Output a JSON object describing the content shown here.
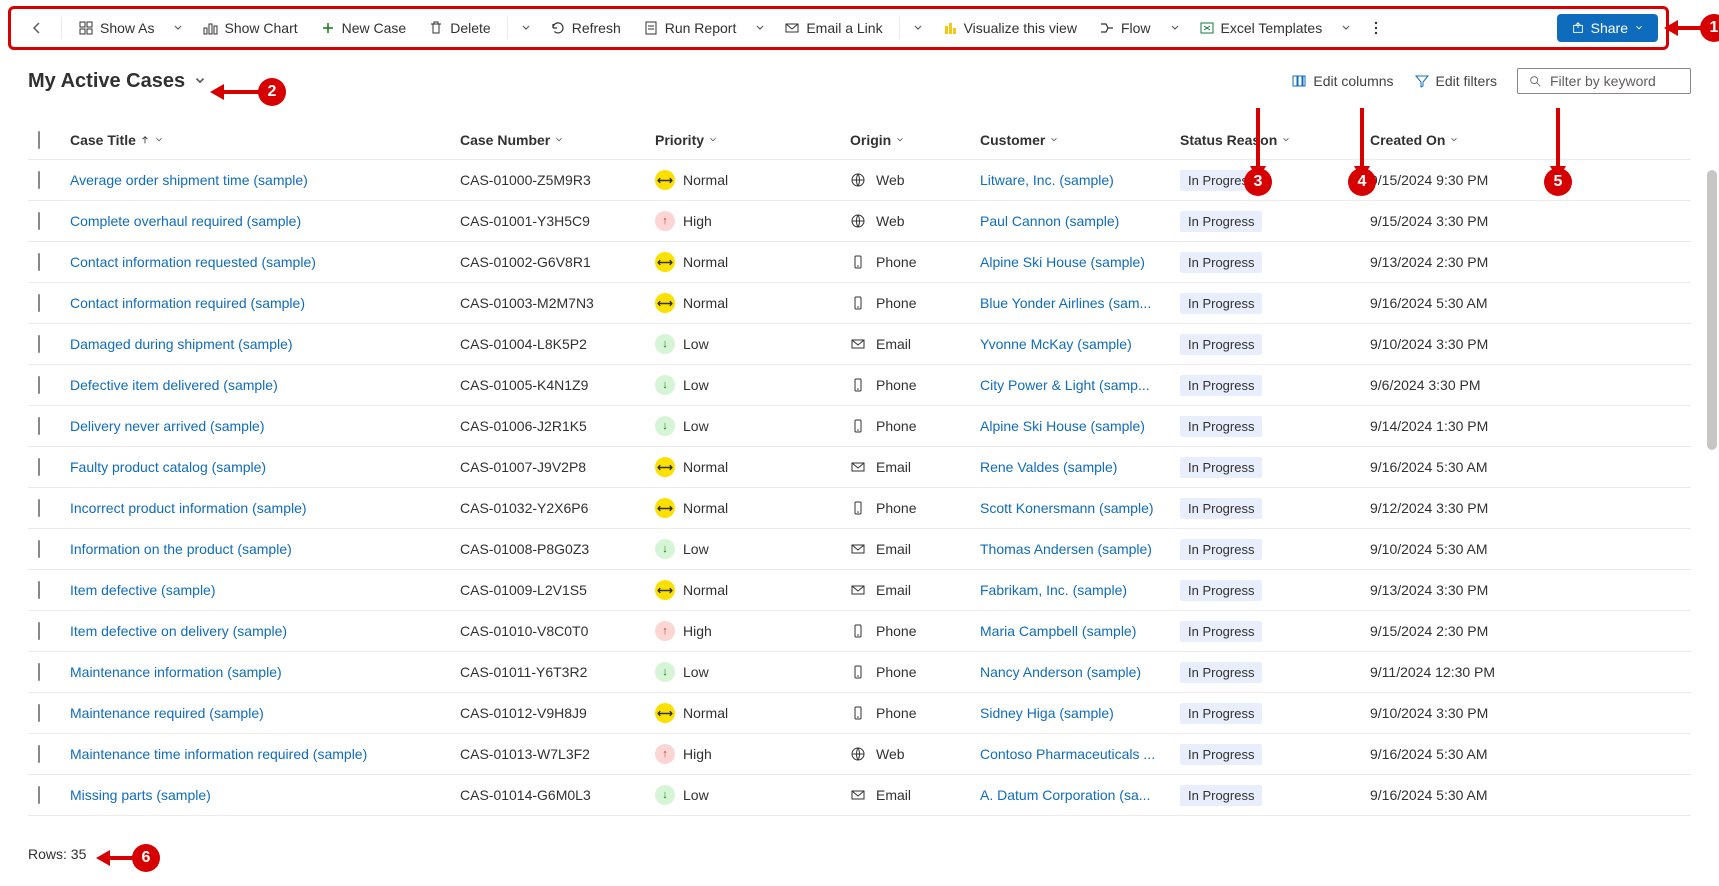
{
  "toolbar": {
    "show_as": "Show As",
    "show_chart": "Show Chart",
    "new_case": "New Case",
    "delete": "Delete",
    "refresh": "Refresh",
    "run_report": "Run Report",
    "email_link": "Email a Link",
    "visualize": "Visualize this view",
    "flow": "Flow",
    "excel_templates": "Excel Templates",
    "share": "Share"
  },
  "view": {
    "title": "My Active Cases",
    "edit_columns": "Edit columns",
    "edit_filters": "Edit filters",
    "search_placeholder": "Filter by keyword"
  },
  "columns": {
    "case_title": "Case Title",
    "case_number": "Case Number",
    "priority": "Priority",
    "origin": "Origin",
    "customer": "Customer",
    "status_reason": "Status Reason",
    "created_on": "Created On"
  },
  "footer": {
    "label": "Rows:",
    "count": "35"
  },
  "rows": [
    {
      "title": "Average order shipment time (sample)",
      "number": "CAS-01000-Z5M9R3",
      "priority": "Normal",
      "origin": "Web",
      "customer": "Litware, Inc. (sample)",
      "status": "In Progress",
      "created": "9/15/2024 9:30 PM"
    },
    {
      "title": "Complete overhaul required (sample)",
      "number": "CAS-01001-Y3H5C9",
      "priority": "High",
      "origin": "Web",
      "customer": "Paul Cannon (sample)",
      "status": "In Progress",
      "created": "9/15/2024 3:30 PM"
    },
    {
      "title": "Contact information requested (sample)",
      "number": "CAS-01002-G6V8R1",
      "priority": "Normal",
      "origin": "Phone",
      "customer": "Alpine Ski House (sample)",
      "status": "In Progress",
      "created": "9/13/2024 2:30 PM"
    },
    {
      "title": "Contact information required (sample)",
      "number": "CAS-01003-M2M7N3",
      "priority": "Normal",
      "origin": "Phone",
      "customer": "Blue Yonder Airlines (sam...",
      "status": "In Progress",
      "created": "9/16/2024 5:30 AM"
    },
    {
      "title": "Damaged during shipment (sample)",
      "number": "CAS-01004-L8K5P2",
      "priority": "Low",
      "origin": "Email",
      "customer": "Yvonne McKay (sample)",
      "status": "In Progress",
      "created": "9/10/2024 3:30 PM"
    },
    {
      "title": "Defective item delivered (sample)",
      "number": "CAS-01005-K4N1Z9",
      "priority": "Low",
      "origin": "Phone",
      "customer": "City Power & Light (samp...",
      "status": "In Progress",
      "created": "9/6/2024 3:30 PM"
    },
    {
      "title": "Delivery never arrived (sample)",
      "number": "CAS-01006-J2R1K5",
      "priority": "Low",
      "origin": "Phone",
      "customer": "Alpine Ski House (sample)",
      "status": "In Progress",
      "created": "9/14/2024 1:30 PM"
    },
    {
      "title": "Faulty product catalog (sample)",
      "number": "CAS-01007-J9V2P8",
      "priority": "Normal",
      "origin": "Email",
      "customer": "Rene Valdes (sample)",
      "status": "In Progress",
      "created": "9/16/2024 5:30 AM"
    },
    {
      "title": "Incorrect product information (sample)",
      "number": "CAS-01032-Y2X6P6",
      "priority": "Normal",
      "origin": "Phone",
      "customer": "Scott Konersmann (sample)",
      "status": "In Progress",
      "created": "9/12/2024 3:30 PM"
    },
    {
      "title": "Information on the product (sample)",
      "number": "CAS-01008-P8G0Z3",
      "priority": "Low",
      "origin": "Email",
      "customer": "Thomas Andersen (sample)",
      "status": "In Progress",
      "created": "9/10/2024 5:30 AM"
    },
    {
      "title": "Item defective (sample)",
      "number": "CAS-01009-L2V1S5",
      "priority": "Normal",
      "origin": "Email",
      "customer": "Fabrikam, Inc. (sample)",
      "status": "In Progress",
      "created": "9/13/2024 3:30 PM"
    },
    {
      "title": "Item defective on delivery (sample)",
      "number": "CAS-01010-V8C0T0",
      "priority": "High",
      "origin": "Phone",
      "customer": "Maria Campbell (sample)",
      "status": "In Progress",
      "created": "9/15/2024 2:30 PM"
    },
    {
      "title": "Maintenance information (sample)",
      "number": "CAS-01011-Y6T3R2",
      "priority": "Low",
      "origin": "Phone",
      "customer": "Nancy Anderson (sample)",
      "status": "In Progress",
      "created": "9/11/2024 12:30 PM"
    },
    {
      "title": "Maintenance required (sample)",
      "number": "CAS-01012-V9H8J9",
      "priority": "Normal",
      "origin": "Phone",
      "customer": "Sidney Higa (sample)",
      "status": "In Progress",
      "created": "9/10/2024 3:30 PM"
    },
    {
      "title": "Maintenance time information required (sample)",
      "number": "CAS-01013-W7L3F2",
      "priority": "High",
      "origin": "Web",
      "customer": "Contoso Pharmaceuticals ...",
      "status": "In Progress",
      "created": "9/16/2024 5:30 AM"
    },
    {
      "title": "Missing parts (sample)",
      "number": "CAS-01014-G6M0L3",
      "priority": "Low",
      "origin": "Email",
      "customer": "A. Datum Corporation (sa...",
      "status": "In Progress",
      "created": "9/16/2024 5:30 AM"
    }
  ],
  "annotations": [
    "1",
    "2",
    "3",
    "4",
    "5",
    "6"
  ]
}
